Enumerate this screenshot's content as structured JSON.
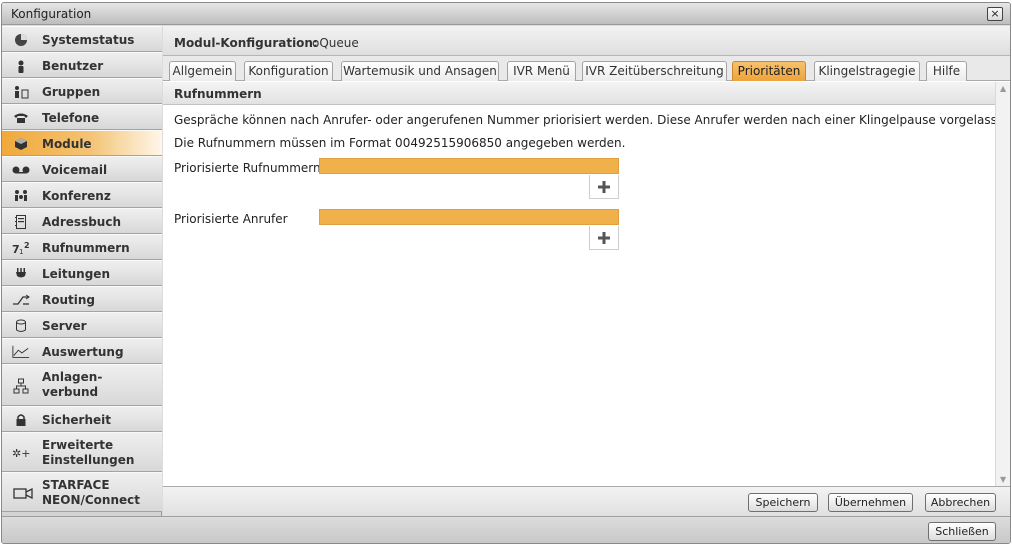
{
  "window": {
    "title": "Konfiguration",
    "close_symbol": "×"
  },
  "sidebar": {
    "items": [
      {
        "label": "Systemstatus",
        "icon": "pie-chart-icon"
      },
      {
        "label": "Benutzer",
        "icon": "user-icon"
      },
      {
        "label": "Gruppen",
        "icon": "users-icon"
      },
      {
        "label": "Telefone",
        "icon": "phone-icon"
      },
      {
        "label": "Module",
        "icon": "cube-icon",
        "active": true
      },
      {
        "label": "Voicemail",
        "icon": "voicemail-icon"
      },
      {
        "label": "Konferenz",
        "icon": "conference-icon"
      },
      {
        "label": "Adressbuch",
        "icon": "addressbook-icon"
      },
      {
        "label": "Rufnummern",
        "icon": "numbers-icon"
      },
      {
        "label": "Leitungen",
        "icon": "plug-icon"
      },
      {
        "label": "Routing",
        "icon": "routing-icon"
      },
      {
        "label": "Server",
        "icon": "server-icon"
      },
      {
        "label": "Auswertung",
        "icon": "stats-icon"
      },
      {
        "label": "Anlagen-",
        "label2": "verbund",
        "icon": "network-icon"
      },
      {
        "label": "Sicherheit",
        "icon": "lock-icon"
      },
      {
        "label": "Erweiterte",
        "label2": "Einstellungen",
        "icon": "settings-icon"
      },
      {
        "label": "STARFACE",
        "label2": "NEON/Connect",
        "icon": "camera-icon"
      }
    ]
  },
  "header": {
    "title": "Modul-Konfiguration:",
    "module": "oQueue"
  },
  "tabs": [
    {
      "label": "Allgemein"
    },
    {
      "label": "Konfiguration"
    },
    {
      "label": "Wartemusik und Ansagen"
    },
    {
      "label": "IVR Menü"
    },
    {
      "label": "IVR Zeitüberschreitung"
    },
    {
      "label": "Prioritäten",
      "active": true
    },
    {
      "label": "Klingelstragegie"
    },
    {
      "label": "Hilfe"
    }
  ],
  "section": {
    "title": "Rufnummern",
    "desc1": "Gespräche können nach Anrufer- oder angerufenen Nummer priorisiert werden. Diese Anrufer werden nach einer Klingelpause vorgelassen.",
    "desc2": "Die Rufnummern müssen im Format 00492515906850 angegeben werden.",
    "field1_label": "Priorisierte Rufnummern",
    "field2_label": "Priorisierte Anrufer"
  },
  "footer": {
    "save": "Speichern",
    "apply": "Übernehmen",
    "cancel": "Abbrechen"
  },
  "bottom": {
    "close": "Schließen"
  },
  "colors": {
    "accent": "#f0b04a",
    "active_tab": "#eda43a"
  }
}
